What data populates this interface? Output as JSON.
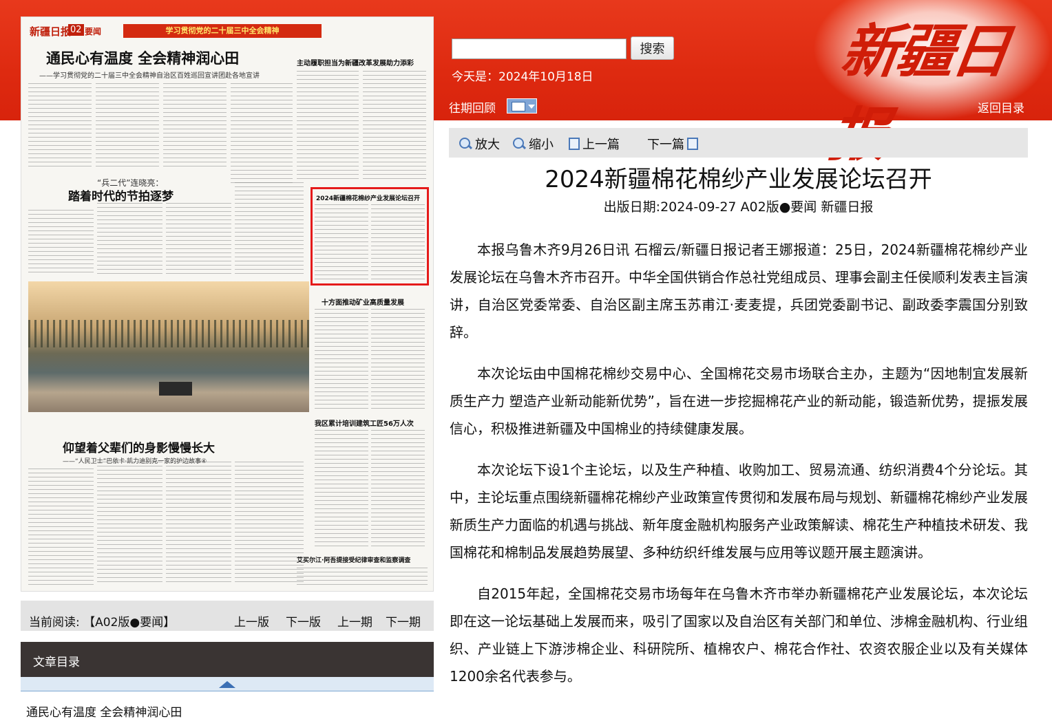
{
  "header": {
    "logo_text": "新疆日报",
    "search_placeholder": "",
    "search_button": "搜索",
    "today": "今天是：2024年10月18日",
    "history_label": "往期回顾",
    "back_label": "返回目录"
  },
  "page_image": {
    "masthead": "新疆日报",
    "page_no": "02",
    "section": "要闻",
    "banner": "学习贯彻党的二十届三中全会精神",
    "headlines": [
      "通民心有温度 全会精神润心田",
      "——学习贯彻党的二十届三中全会精神自治区百姓巡回宣讲团赴各地宣讲",
      "主动履职担当为新疆改革发展助力添彩",
      "“兵二代”连晓亮：",
      "踏着时代的节拍逐梦",
      "2024新疆棉花棉纱产业发展论坛召开",
      "十方面推动矿业高质量发展",
      "我区累计培训建筑工匠56万人次",
      "仰望着父辈们的身影慢慢长大",
      "——“人民卫士”巴依卡·凯力迪别克一家的护边故事④",
      "艾买尔江·阿吾提接受纪律审查和监察调查"
    ]
  },
  "current_read": {
    "label": "当前阅读:  【A02版●要闻】",
    "nav": [
      "上一版",
      "下一版",
      "上一期",
      "下一期"
    ]
  },
  "toc": {
    "heading": "文章目录",
    "items": [
      "通民心有温度 全会精神润心田"
    ]
  },
  "toolbar": {
    "zoom_in": "放大",
    "zoom_out": "缩小",
    "prev": "上一篇",
    "next": "下一篇"
  },
  "article": {
    "title": "2024新疆棉花棉纱产业发展论坛召开",
    "meta": "出版日期:2024-09-27   A02版●要闻   新疆日报",
    "paragraphs": [
      "本报乌鲁木齐9月26日讯 石榴云/新疆日报记者王娜报道：25日，2024新疆棉花棉纱产业发展论坛在乌鲁木齐市召开。中华全国供销合作总社党组成员、理事会副主任侯顺利发表主旨演讲，自治区党委常委、自治区副主席玉苏甫江·麦麦提，兵团党委副书记、副政委李震国分别致辞。",
      "本次论坛由中国棉花棉纱交易中心、全国棉花交易市场联合主办，主题为“因地制宜发展新质生产力 塑造产业新动能新优势”，旨在进一步挖掘棉花产业的新动能，锻造新优势，提振发展信心，积极推进新疆及中国棉业的持续健康发展。",
      "本次论坛下设1个主论坛，以及生产种植、收购加工、贸易流通、纺织消费4个分论坛。其中，主论坛重点围绕新疆棉花棉纱产业政策宣传贯彻和发展布局与规划、新疆棉花棉纱产业发展新质生产力面临的机遇与挑战、新年度金融机构服务产业政策解读、棉花生产种植技术研发、我国棉花和棉制品发展趋势展望、多种纺织纤维发展与应用等议题开展主题演讲。",
      "自2015年起，全国棉花交易市场每年在乌鲁木齐市举办新疆棉花产业发展论坛，本次论坛即在这一论坛基础上发展而来，吸引了国家以及自治区有关部门和单位、涉棉金融机构、行业组织、产业链上下游涉棉企业、科研院所、植棉农户、棉花合作社、农资农服企业以及有关媒体1200余名代表参与。"
    ]
  }
}
